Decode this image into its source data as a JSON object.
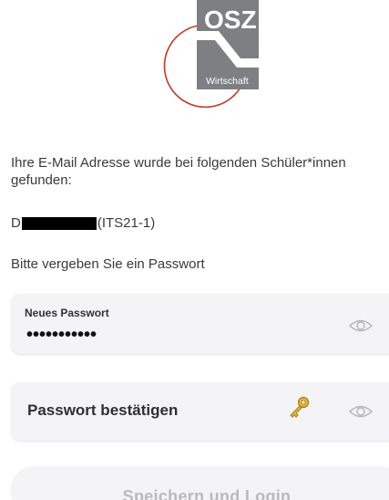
{
  "logo": {
    "text_top": "OSZ",
    "text_bottom": "Wirtschaft",
    "colors": {
      "box": "#7d7f83",
      "arc": "#c0392b"
    }
  },
  "intro_text": "Ihre E-Mail Adresse wurde bei folgenden Schüler*innen gefunden:",
  "student": {
    "prefix": "D",
    "class": "(ITS21-1)"
  },
  "prompt_text": "Bitte vergeben Sie ein Passwort",
  "new_password": {
    "label": "Neues Passwort",
    "value": "•••••••••••",
    "icon": "eye-icon"
  },
  "confirm_password": {
    "placeholder": "Passwort bestätigen",
    "icons": [
      "key-icon",
      "eye-icon"
    ]
  },
  "save_button": {
    "label": "Speichern und Login",
    "state": "disabled"
  },
  "colors": {
    "field_bg": "#f4f4f6",
    "button_text_disabled": "#b9b9be"
  }
}
